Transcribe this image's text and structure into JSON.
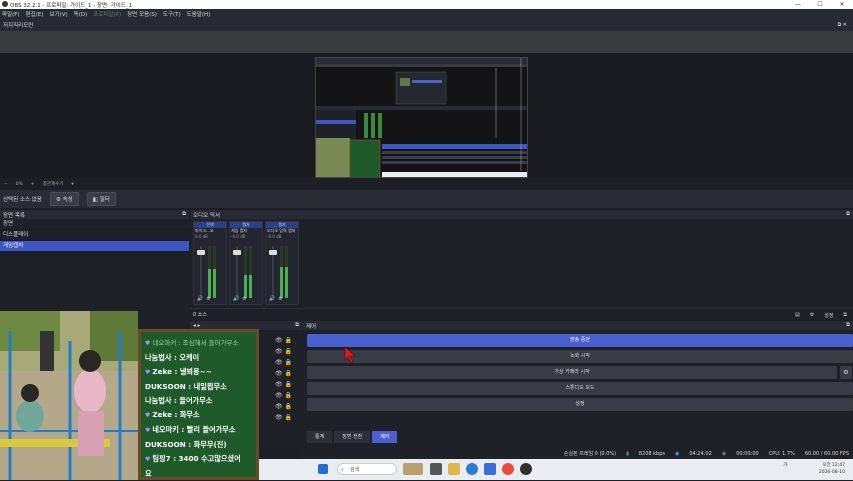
{
  "window": {
    "title": "OBS 32.2.1 - 프로파일: 가이드_1 - 장면: 가이드_1"
  },
  "menu": [
    "파일(F)",
    "편집(E)",
    "보기(V)",
    "독(D)",
    "프로파일(P)",
    "장면 모음(S)",
    "도구(T)",
    "도움말(H)"
  ],
  "preview": {
    "title": "저지직리모컨"
  },
  "preview_toolbar": {
    "zoom": "0%",
    "label": "창관계수기"
  },
  "source_bar": {
    "label": "선택된 소스 없음",
    "properties": "속성",
    "filters": "필터"
  },
  "scenes": {
    "title": "장면 목록",
    "items": [
      "장면",
      "디스플레이",
      "게임캡처"
    ],
    "selected_index": 2
  },
  "mixer": {
    "title": "오디오 믹서",
    "channels": [
      {
        "head": "전체",
        "name": "마이크...요",
        "db": "0.0 dB",
        "level": 0.55
      },
      {
        "head": "캡처",
        "name": "게임 캡처",
        "db": "-0.0 dB",
        "level": 0.45
      },
      {
        "head": "캡처",
        "name": "오디오 입력 캡처",
        "db": "-0.0 dB",
        "level": 0.6
      }
    ],
    "foot_label": "0 소스",
    "settings_label": "설정"
  },
  "transitions": {
    "title": "장면 전환"
  },
  "controls": {
    "title": "제어",
    "buttons": [
      "방송 중단",
      "녹화 시작",
      "가상 카메라 시작",
      "스튜디오 모드",
      "설정"
    ],
    "tabs": [
      "통계",
      "장면 전환",
      "제어"
    ]
  },
  "status": {
    "dropped": "손실된 프레임 0 (0.0%)",
    "bitrate": "8208 kbps",
    "stream_time": "04:24:02",
    "rec_time": "00:00:00",
    "cpu": "CPU: 1.7%",
    "fps": "60.00 / 60.00 FPS"
  },
  "chat": {
    "lines": [
      {
        "text": "네오마키 : 조심해서 들어가무소",
        "faded": true,
        "heart": true
      },
      {
        "text": "나눔법사 : 오케이",
        "faded": false,
        "heart": false
      },
      {
        "text": "Zeke : 낼뵈용~~",
        "faded": false,
        "heart": true
      },
      {
        "text": "DUKSOON : 내일뵙무소",
        "faded": false,
        "heart": false
      },
      {
        "text": "나눔법사 : 들어가무소",
        "faded": false,
        "heart": false
      },
      {
        "text": "Zeke : 화무소",
        "faded": false,
        "heart": true
      },
      {
        "text": "네오마키 : 빨리 들어가무소",
        "faded": false,
        "heart": true
      },
      {
        "text": "DUKSOON : 화무무(진)",
        "faded": false,
        "heart": false
      },
      {
        "text": "팀핑7 : 3400 수고많으셨어",
        "faded": false,
        "heart": true
      },
      {
        "text": "요",
        "faded": false,
        "heart": false
      }
    ]
  },
  "taskbar": {
    "search_placeholder": "검색",
    "time": "오전 12:47",
    "date": "2026-08-10",
    "lang": "가"
  },
  "colors": {
    "accent": "#4a5fd0",
    "selected": "#3c57c4",
    "chat_bg": "#1f5b2a"
  }
}
